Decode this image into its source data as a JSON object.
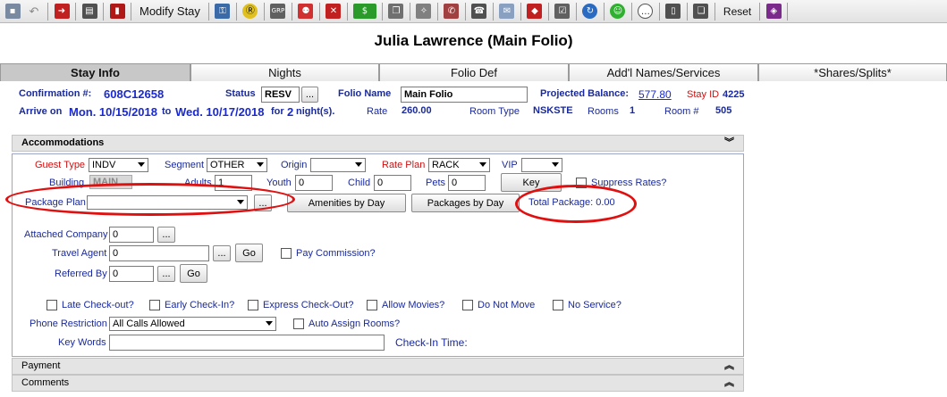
{
  "toolbar": {
    "modify_stay": "Modify Stay",
    "reset": "Reset"
  },
  "title": "Julia Lawrence (Main Folio)",
  "tabs": [
    "Stay Info",
    "Nights",
    "Folio Def",
    "Add'l Names/Services",
    "*Shares/Splits*"
  ],
  "stay": {
    "confirmation_label": "Confirmation #:",
    "confirmation": "608C12658",
    "status_label": "Status",
    "status": "RESV",
    "folio_name_label": "Folio Name",
    "folio_name": "Main Folio",
    "projected_balance_label": "Projected Balance:",
    "projected_balance": "577.80",
    "stay_id_label": "Stay ID",
    "stay_id": "4225",
    "arrive_label": "Arrive on",
    "arrive": "Mon. 10/15/2018",
    "to_label": "to",
    "depart": "Wed. 10/17/2018",
    "for_label": "for",
    "nights": "2",
    "nights_label": "night(s).",
    "rate_label": "Rate",
    "rate": "260.00",
    "room_type_label": "Room Type",
    "room_type": "NSKSTE",
    "rooms_label": "Rooms",
    "rooms": "1",
    "room_no_label": "Room #",
    "room_no": "505"
  },
  "accommodations": {
    "header": "Accommodations",
    "guest_type_label": "Guest Type",
    "guest_type": "INDV",
    "segment_label": "Segment",
    "segment": "OTHER",
    "origin_label": "Origin",
    "origin": "",
    "rate_plan_label": "Rate Plan",
    "rate_plan": "RACK",
    "vip_label": "VIP",
    "vip": "",
    "building_label": "Building",
    "building": "MAIN",
    "adults_label": "Adults",
    "adults": "1",
    "youth_label": "Youth",
    "youth": "0",
    "child_label": "Child",
    "child": "0",
    "pets_label": "Pets",
    "pets": "0",
    "key_button": "Key",
    "suppress_rates": "Suppress Rates?",
    "package_plan_label": "Package Plan",
    "package_plan": "",
    "ellipsis": "...",
    "amenities_button": "Amenities by Day",
    "packages_button": "Packages by Day",
    "total_package": "Total Package: 0.00",
    "attached_company_label": "Attached Company",
    "attached_company": "0",
    "travel_agent_label": "Travel Agent",
    "travel_agent": "0",
    "go": "Go",
    "pay_commission": "Pay Commission?",
    "referred_by_label": "Referred By",
    "referred_by": "0",
    "late_checkout": "Late Check-out?",
    "early_checkin": "Early Check-In?",
    "express_checkout": "Express Check-Out?",
    "allow_movies": "Allow Movies?",
    "do_not_move": "Do Not Move",
    "no_service": "No Service?",
    "phone_restriction_label": "Phone Restriction",
    "phone_restriction": "All Calls Allowed",
    "auto_assign_rooms": "Auto Assign Rooms?",
    "key_words_label": "Key Words",
    "key_words": "",
    "checkin_time_label": "Check-In Time:"
  },
  "panels": {
    "payment": "Payment",
    "comments": "Comments"
  },
  "colors": {
    "label_blue": "#1a2a9a",
    "required_red": "#d01010",
    "annotation_red": "#e01010"
  }
}
